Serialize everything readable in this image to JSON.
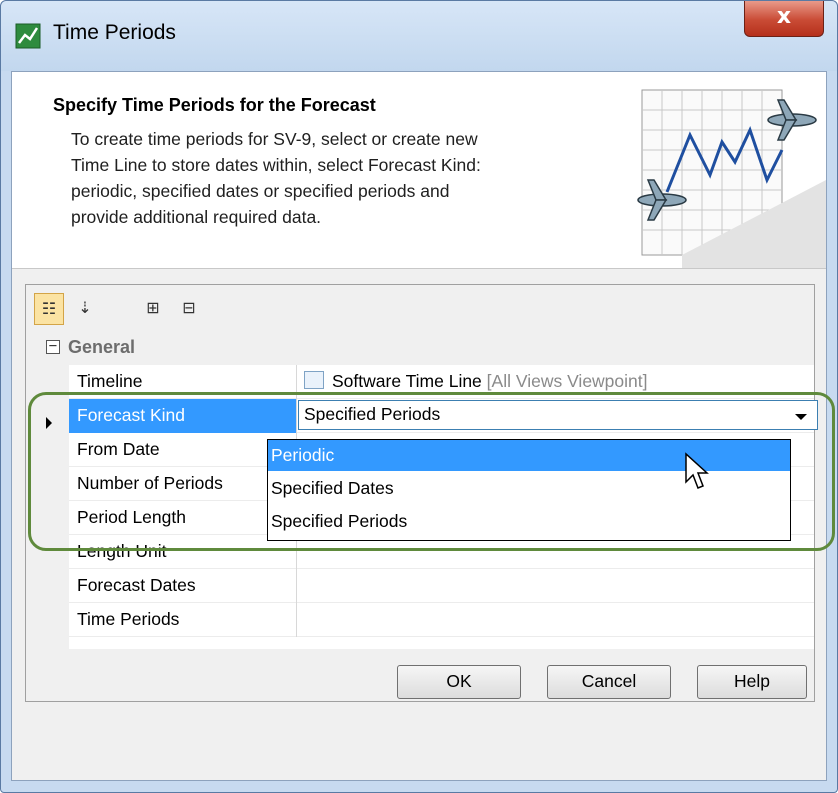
{
  "window": {
    "title": "Time Periods",
    "close_label": "x"
  },
  "header": {
    "title": "Specify Time Periods for the Forecast",
    "description": "To create time periods for SV-9, select or create new\nTime Line to store dates within, select Forecast Kind:\nperiodic, specified dates or specified periods and\nprovide additional required data."
  },
  "toolbar": {
    "buttons": [
      {
        "icon": "categorized-view-icon",
        "active": true
      },
      {
        "icon": "sort-alphabetical-icon",
        "active": false
      },
      {
        "icon": "expand-all-icon",
        "active": false
      },
      {
        "icon": "collapse-all-icon",
        "active": false
      }
    ]
  },
  "properties": {
    "group_label": "General",
    "group_expanded": true,
    "rows": [
      {
        "name": "Timeline",
        "value": "Software Time Line",
        "value_extra": "[All Views Viewpoint]"
      },
      {
        "name": "Forecast Kind",
        "value": "Specified Periods",
        "selected": true
      },
      {
        "name": "From Date",
        "value": ""
      },
      {
        "name": "Number of Periods",
        "value": ""
      },
      {
        "name": "Period Length",
        "value": ""
      },
      {
        "name": "Length Unit",
        "value": ""
      },
      {
        "name": "Forecast Dates",
        "value": ""
      },
      {
        "name": "Time Periods",
        "value": ""
      }
    ]
  },
  "dropdown": {
    "options": [
      "Periodic",
      "Specified Dates",
      "Specified Periods"
    ],
    "hovered": "Periodic"
  },
  "buttons": {
    "ok": "OK",
    "cancel": "Cancel",
    "help": "Help"
  },
  "colors": {
    "selection": "#3399ff",
    "highlight_outline": "#5f8a3c",
    "close_button": "#c94b35"
  }
}
